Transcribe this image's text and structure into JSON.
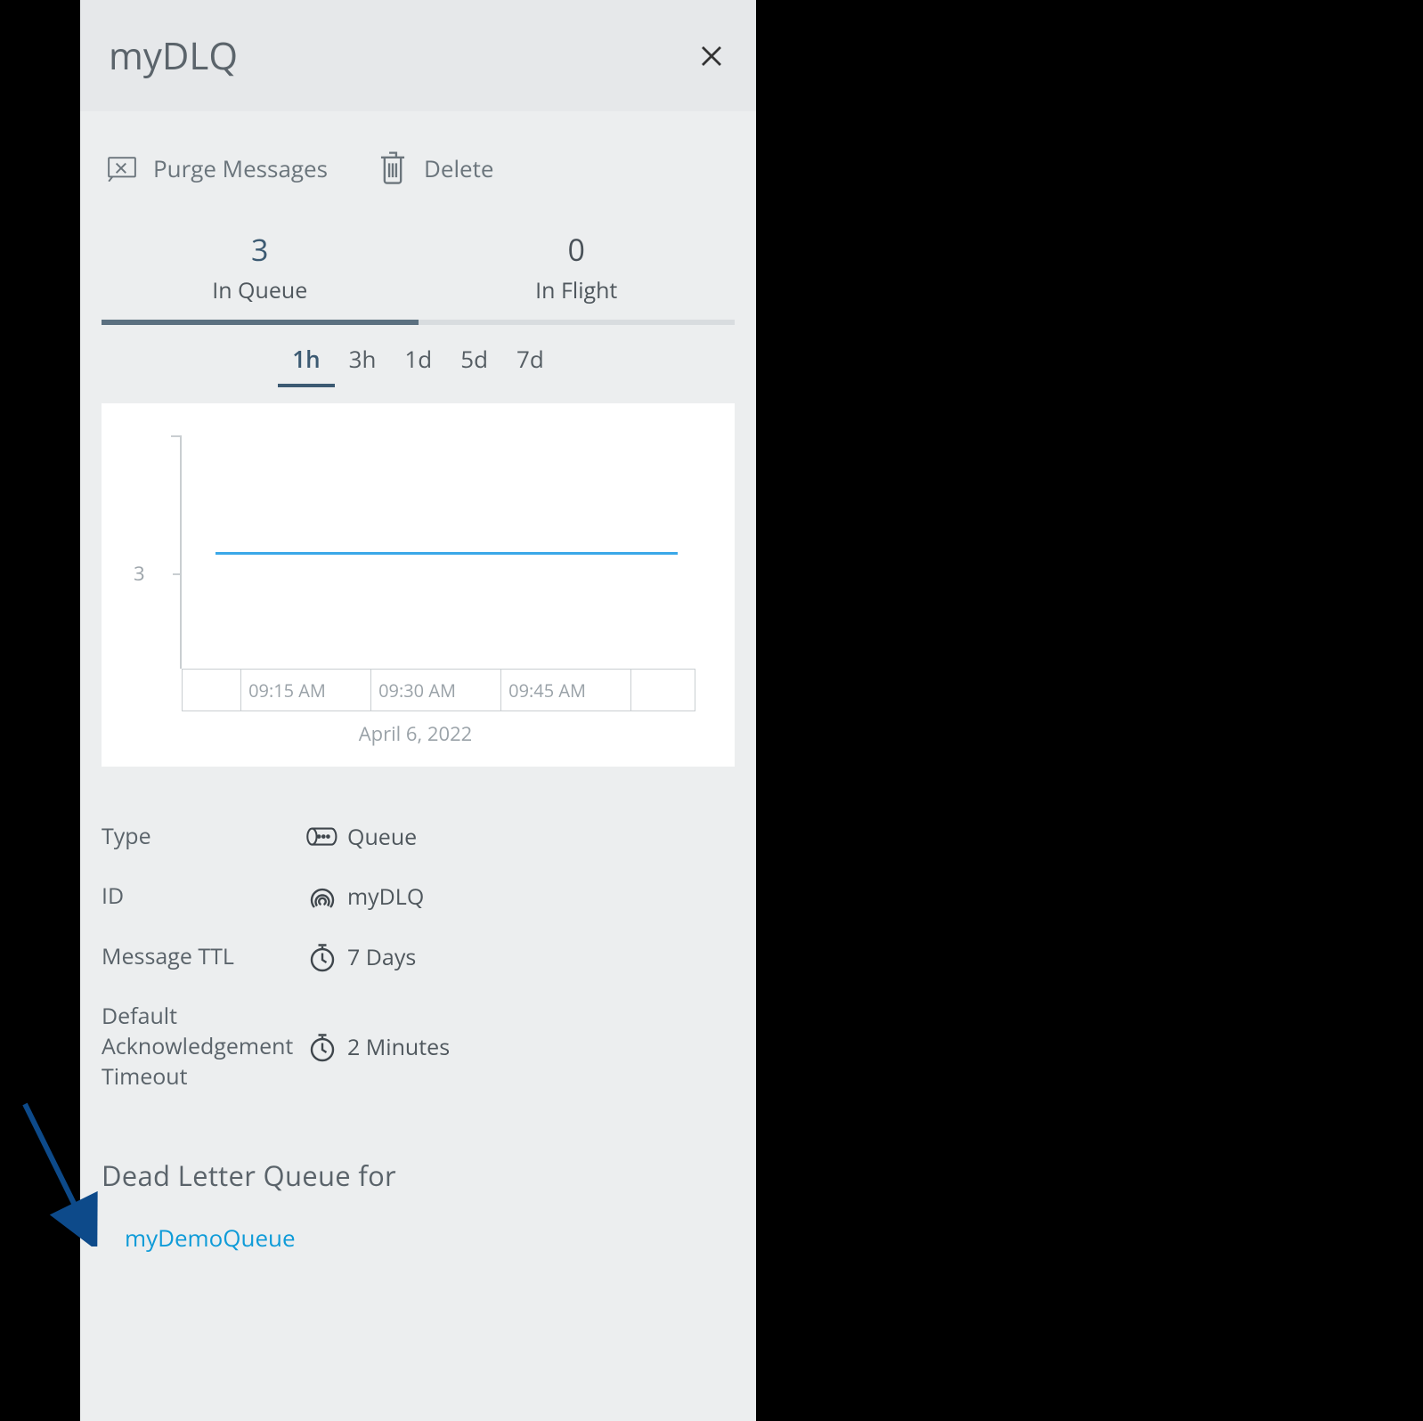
{
  "header": {
    "title": "myDLQ"
  },
  "actions": {
    "purge": "Purge Messages",
    "delete": "Delete"
  },
  "tabs": [
    {
      "count": "3",
      "label": "In Queue",
      "active": true
    },
    {
      "count": "0",
      "label": "In Flight",
      "active": false
    }
  ],
  "time_ranges": [
    "1h",
    "3h",
    "1d",
    "5d",
    "7d"
  ],
  "time_range_active": 0,
  "chart_data": {
    "type": "line",
    "y_ticks": [
      3
    ],
    "x_ticks": [
      "09:15 AM",
      "09:30 AM",
      "09:45 AM"
    ],
    "date": "April 6, 2022",
    "series": [
      {
        "name": "In Queue",
        "value_constant": 3
      }
    ],
    "ylim": [
      0,
      6
    ]
  },
  "properties": [
    {
      "label": "Type",
      "icon": "queue",
      "value": "Queue"
    },
    {
      "label": "ID",
      "icon": "fingerprint",
      "value": "myDLQ"
    },
    {
      "label": "Message TTL",
      "icon": "clock",
      "value": "7 Days"
    },
    {
      "label": "Default Acknowledgement Timeout",
      "icon": "clock",
      "value": "2 Minutes"
    }
  ],
  "dlq_section": {
    "title": "Dead Letter Queue for",
    "link": "myDemoQueue"
  }
}
